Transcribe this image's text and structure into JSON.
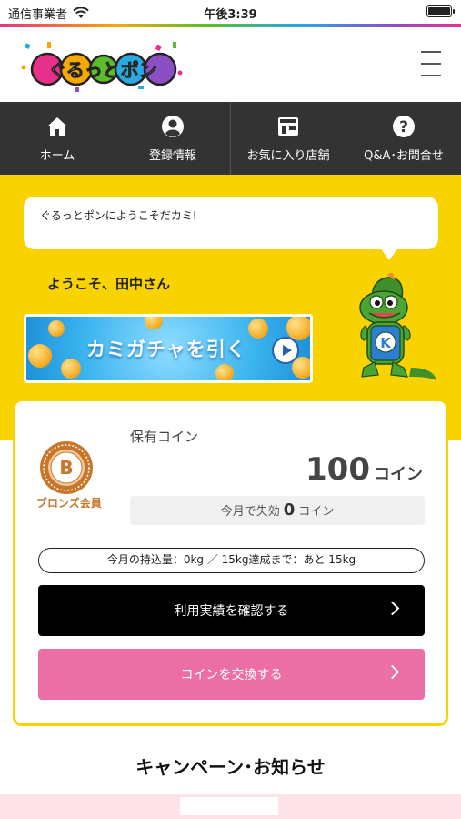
{
  "status_bar": {
    "carrier": "通信事業者",
    "time": "午後3:39",
    "icons": [
      "wifi-icon",
      "battery-icon"
    ]
  },
  "header": {
    "logo_text": "ぐるっとポン",
    "menu_icon": "hamburger-icon"
  },
  "nav": {
    "items": [
      {
        "label": "ホーム",
        "icon": "home-icon"
      },
      {
        "label": "登録情報",
        "icon": "user-icon"
      },
      {
        "label": "お気に入り店舗",
        "icon": "store-icon"
      },
      {
        "label": "Q&A･お問合せ",
        "icon": "question-icon"
      }
    ]
  },
  "hero": {
    "bubble_text": "ぐるっとポンにようこそだカミ!",
    "welcome": "ようこそ、田中さん",
    "gacha_label": "カミガチャを引く",
    "mascot_letter": "K"
  },
  "coins": {
    "rank_letter": "B",
    "rank_label": "ブロンズ会員",
    "title": "保有コイン",
    "amount": "100",
    "unit": "コイン",
    "expire_prefix": "今月で失効",
    "expire_amount": "0",
    "expire_unit": "コイン",
    "weight_text": "今月の持込量：0kg ／ 15kg達成まで：あと 15kg",
    "usage_button": "利用実績を確認する",
    "exchange_button": "コインを交換する"
  },
  "campaign": {
    "title": "キャンペーン･お知らせ"
  },
  "colors": {
    "yellow": "#f9d300",
    "nav_bg": "#333333",
    "exchange_pink": "#eb6ea5",
    "bronze": "#c8772a"
  }
}
